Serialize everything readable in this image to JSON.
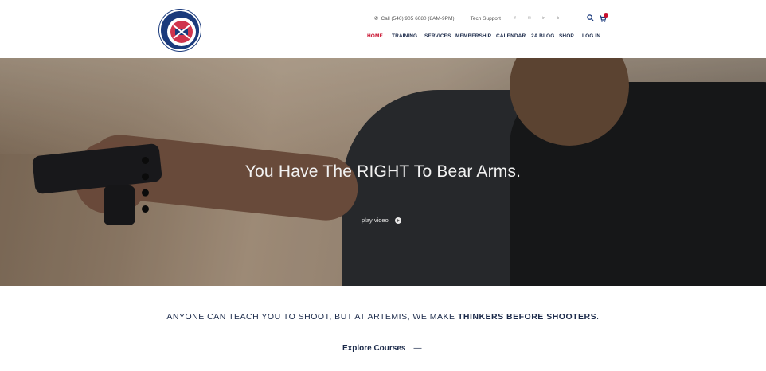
{
  "header": {
    "logo_text": "ARTEMIS DEFENSE INSTITUTE",
    "phone": "Call (540) 905 6080 (8AM-9PM)",
    "tech_support": "Tech Support",
    "socials": [
      "f",
      "✉",
      "in",
      "b"
    ],
    "cart_count": "0"
  },
  "nav": {
    "items": [
      "HOME",
      "TRAINING",
      "SERVICES",
      "MEMBERSHIP",
      "CALENDAR",
      "2A BLOG",
      "SHOP",
      "LOG IN"
    ],
    "active": "HOME"
  },
  "hero": {
    "title": "You Have The RIGHT To Bear Arms.",
    "play_label": "play video"
  },
  "tagline": {
    "prefix": "ANYONE CAN TEACH YOU TO SHOOT, BUT AT ARTEMIS, WE MAKE ",
    "emphasis": "THINKERS BEFORE SHOOTERS",
    "suffix": "."
  },
  "cta": {
    "label": "Explore Courses",
    "arrow": "—"
  }
}
